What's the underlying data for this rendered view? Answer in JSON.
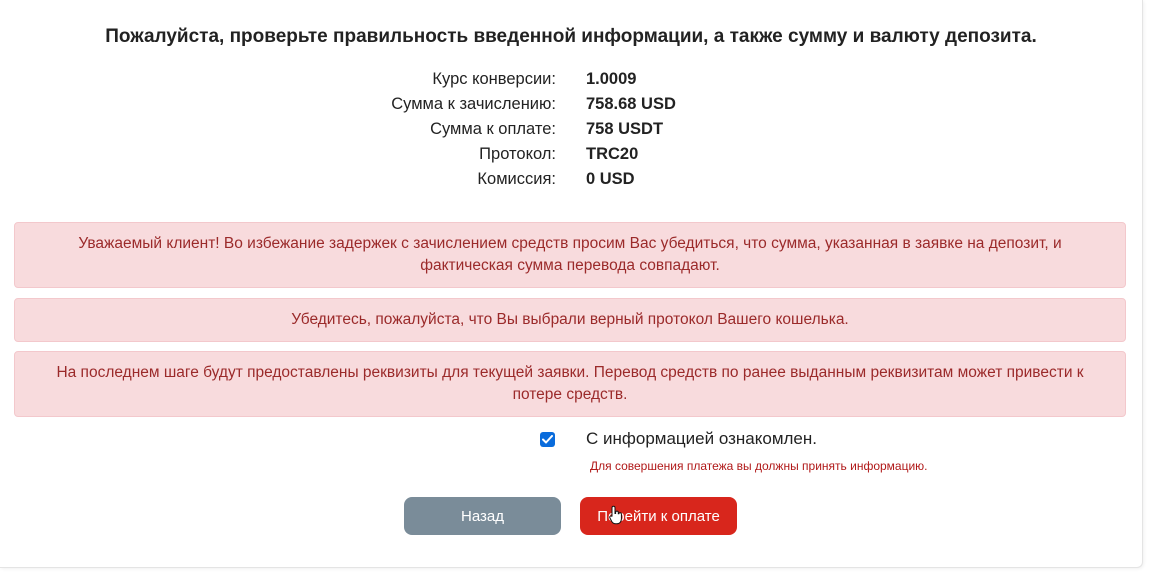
{
  "heading": "Пожалуйста, проверьте правильность введенной информации, а также сумму и валюту депозита.",
  "summary": [
    {
      "label": "Курс конверсии:",
      "value": "1.0009"
    },
    {
      "label": "Сумма к зачислению:",
      "value": "758.68 USD"
    },
    {
      "label": "Сумма к оплате:",
      "value": "758 USDT"
    },
    {
      "label": "Протокол:",
      "value": "TRC20"
    },
    {
      "label": "Комиссия:",
      "value": "0 USD"
    }
  ],
  "alerts": [
    "Уважаемый клиент! Во избежание задержек с зачислением средств просим Вас убедиться, что сумма, указанная в заявке на депозит, и фактическая сумма перевода совпадают.",
    "Убедитесь, пожалуйста, что Вы выбрали верный протокол Вашего кошелька.",
    "На последнем шаге будут предоставлены реквизиты для текущей заявки. Перевод средств по ранее выданным реквизитам может привести к потере средств."
  ],
  "agreement": {
    "checked": true,
    "label": "С информацией ознакомлен.",
    "hint": "Для совершения платежа вы должны принять информацию."
  },
  "buttons": {
    "back": "Назад",
    "pay": "Перейти к оплате"
  },
  "colors": {
    "alert_bg": "#f8dbdd",
    "alert_text": "#9b2a2a",
    "back_button": "#7a8c99",
    "pay_button": "#d8261c",
    "checkbox": "#0a6cdc"
  }
}
